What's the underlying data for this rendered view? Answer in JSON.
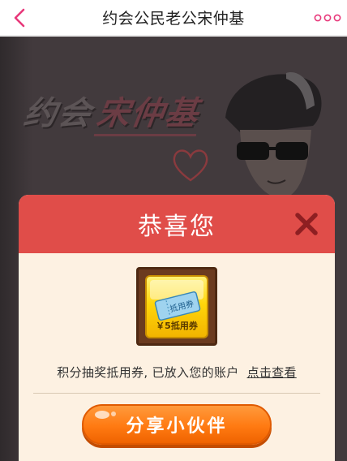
{
  "navbar": {
    "title": "约会公民老公宋仲基",
    "back_icon": "chevron-left-icon",
    "more_icon": "ellipsis-icon",
    "accent_color": "#e8387a"
  },
  "banner": {
    "logo_part1": "约会",
    "logo_part2": "宋仲基"
  },
  "dialog": {
    "title": "恭喜您",
    "close_icon": "close-icon",
    "header_color": "#e04d49",
    "prize": {
      "ticket_label": "抵用券",
      "amount_label": "￥5抵用券"
    },
    "message": "积分抽奖抵用券, 已放入您的账户",
    "view_link": "点击查看",
    "share_button": "分享小伙伴",
    "button_color": "#ff7a12"
  }
}
